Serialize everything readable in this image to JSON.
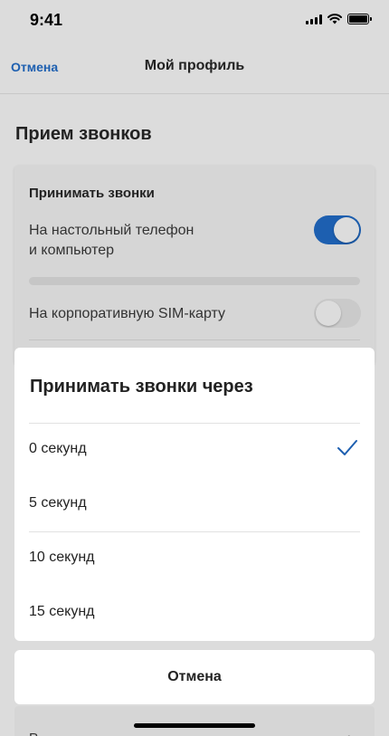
{
  "status_bar": {
    "time": "9:41"
  },
  "nav": {
    "cancel_label": "Отмена",
    "title": "Мой профиль"
  },
  "section": {
    "title": "Прием звонков"
  },
  "card": {
    "heading": "Принимать звонки",
    "row1": {
      "label_line1": "На настольный телефон",
      "label_line2": "и компьютер",
      "enabled": true
    },
    "row2": {
      "label": "На корпоративную SIM-карту",
      "enabled": false
    }
  },
  "bottom_card": {
    "text": "Р"
  },
  "sheet": {
    "title": "Принимать звонки через",
    "options": [
      {
        "label": "0 секунд",
        "selected": true
      },
      {
        "label": "5 секунд",
        "selected": false
      },
      {
        "label": "10 секунд",
        "selected": false
      },
      {
        "label": "15 секунд",
        "selected": false
      }
    ],
    "cancel_label": "Отмена"
  },
  "colors": {
    "accent": "#1d5fb0",
    "overlay_bg": "#dcdcdc",
    "sheet_bg": "#ffffff"
  }
}
